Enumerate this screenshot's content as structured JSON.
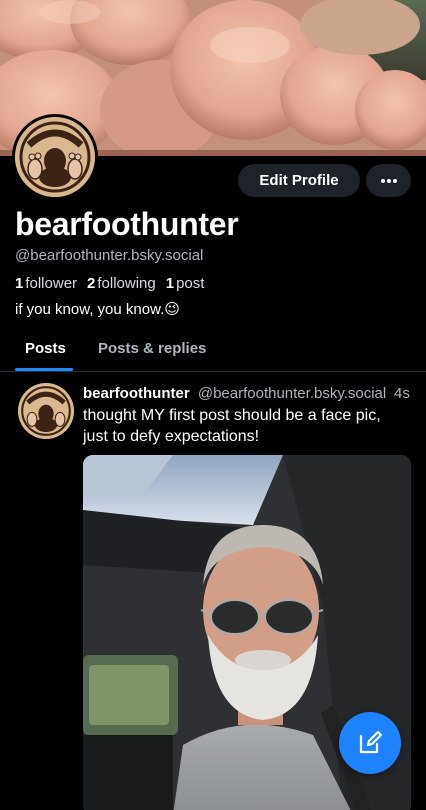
{
  "profile": {
    "display_name": "bearfoothunter",
    "handle": "@bearfoothunter.bsky.social",
    "stats": {
      "followers_count": "1",
      "followers_label": "follower",
      "following_count": "2",
      "following_label": "following",
      "posts_count": "1",
      "posts_label": "post"
    },
    "bio": "if you know, you know.😉",
    "avatar_logo_text": "BEARFOOTHUNTER"
  },
  "actions": {
    "edit_profile_label": "Edit Profile",
    "more_icon": "more-horizontal-icon"
  },
  "tabs": [
    {
      "label": "Posts",
      "active": true
    },
    {
      "label": "Posts & replies",
      "active": false
    }
  ],
  "feed": [
    {
      "author_name": "bearfoothunter",
      "author_handle": "@bearfoothunter.bsky.social",
      "time": "4s",
      "text": "thought MY first post should be a face pic, just to defy expectations!"
    }
  ],
  "compose_icon": "compose-pencil-icon",
  "colors": {
    "accent": "#1f82ff",
    "button_bg": "#1e2329",
    "muted_text": "#aeb5bd"
  }
}
